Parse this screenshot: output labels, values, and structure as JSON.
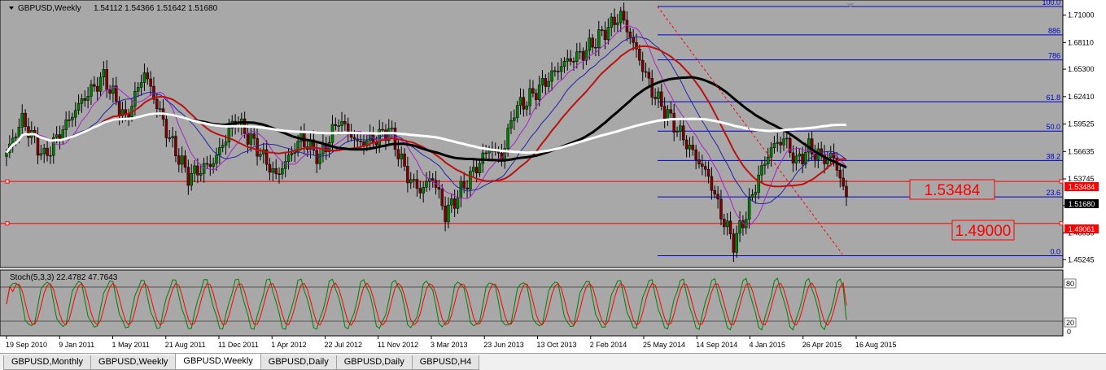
{
  "header": {
    "symbol": "GBPUSD,Weekly",
    "ohlc": "1.54112 1.54366 1.51642 1.51680"
  },
  "stoch_header": "Stoch(5,3,3) 22.4782 47.7643",
  "colors": {
    "chart_bg": "#a8a8a8",
    "grid": "#909090",
    "candle_up": "#008000",
    "candle_down": "#800000",
    "fib_line": "#0000cc",
    "hline": "#ff0000",
    "stoch_main": "#008000",
    "stoch_signal": "#ff0000",
    "ma_white": "#ffffff",
    "ma_black": "#000000",
    "ma_red": "#bb1111",
    "ma_blue": "#2222aa",
    "ma_purple": "#aa22cc"
  },
  "price_axis": {
    "ticks": [
      "1.71000",
      "1.68110",
      "1.65300",
      "1.62410",
      "1.59525",
      "1.56635",
      "1.53745",
      "1.50940",
      "1.48050",
      "1.45245"
    ],
    "current_price": "1.51680",
    "line_1_label": "1.53484",
    "line_2_label": "1.49061"
  },
  "time_axis": {
    "labels": [
      "19 Sep 2010",
      "9 Jan 2011",
      "1 May 2011",
      "21 Aug 2011",
      "11 Dec 2011",
      "1 Apr 2012",
      "22 Jul 2012",
      "11 Nov 2012",
      "3 Mar 2013",
      "23 Jun 2013",
      "13 Oct 2013",
      "2 Feb 2014",
      "25 May 2014",
      "14 Sep 2014",
      "4 Jan 2015",
      "26 Apr 2015",
      "16 Aug 2015"
    ]
  },
  "fib_levels": [
    "100.0",
    "886",
    "786",
    "61.8",
    "50.0",
    "38.2",
    "23.6",
    "0.0"
  ],
  "big_labels": {
    "level_1": "1.53484",
    "level_2": "1.49000"
  },
  "stoch_axis": [
    "80",
    "20",
    "0"
  ],
  "tabs": [
    {
      "label": "GBPUSD,Monthly",
      "active": false
    },
    {
      "label": "GBPUSD,Weekly",
      "active": false
    },
    {
      "label": "GBPUSD,Weekly",
      "active": true
    },
    {
      "label": "GBPUSD,Daily",
      "active": false
    },
    {
      "label": "GBPUSD,Daily",
      "active": false
    },
    {
      "label": "GBPUSD,H4",
      "active": false
    }
  ],
  "chart_data": {
    "type": "candlestick",
    "symbol": "GBPUSD",
    "timeframe": "Weekly",
    "ylim": [
      1.445,
      1.725
    ],
    "horizontal_lines": [
      1.53484,
      1.49061
    ],
    "fibonacci": {
      "high": 1.719,
      "low": 1.4566,
      "levels": [
        {
          "label": "100.0",
          "price": 1.719
        },
        {
          "label": "886",
          "price": 1.6891
        },
        {
          "label": "786",
          "price": 1.6628
        },
        {
          "label": "61.8",
          "price": 1.6187
        },
        {
          "label": "50.0",
          "price": 1.5878
        },
        {
          "label": "38.2",
          "price": 1.5568
        },
        {
          "label": "23.6",
          "price": 1.5185
        },
        {
          "label": "0.0",
          "price": 1.4566
        }
      ]
    },
    "price_path": [
      [
        0,
        1.565
      ],
      [
        5,
        1.6
      ],
      [
        12,
        1.56
      ],
      [
        18,
        1.59
      ],
      [
        24,
        1.62
      ],
      [
        31,
        1.645
      ],
      [
        38,
        1.6
      ],
      [
        44,
        1.65
      ],
      [
        52,
        1.58
      ],
      [
        58,
        1.54
      ],
      [
        66,
        1.555
      ],
      [
        73,
        1.6
      ],
      [
        80,
        1.57
      ],
      [
        86,
        1.54
      ],
      [
        94,
        1.58
      ],
      [
        100,
        1.56
      ],
      [
        106,
        1.6
      ],
      [
        112,
        1.575
      ],
      [
        118,
        1.58
      ],
      [
        122,
        1.59
      ],
      [
        128,
        1.54
      ],
      [
        132,
        1.525
      ],
      [
        136,
        1.54
      ],
      [
        140,
        1.5
      ],
      [
        145,
        1.525
      ],
      [
        150,
        1.55
      ],
      [
        154,
        1.57
      ],
      [
        158,
        1.56
      ],
      [
        162,
        1.61
      ],
      [
        166,
        1.62
      ],
      [
        172,
        1.64
      ],
      [
        178,
        1.66
      ],
      [
        184,
        1.67
      ],
      [
        190,
        1.69
      ],
      [
        196,
        1.71
      ],
      [
        200,
        1.68
      ],
      [
        206,
        1.63
      ],
      [
        212,
        1.6
      ],
      [
        218,
        1.57
      ],
      [
        224,
        1.54
      ],
      [
        228,
        1.5
      ],
      [
        232,
        1.47
      ],
      [
        236,
        1.5
      ],
      [
        240,
        1.54
      ],
      [
        244,
        1.57
      ],
      [
        248,
        1.58
      ],
      [
        252,
        1.555
      ],
      [
        256,
        1.57
      ],
      [
        260,
        1.56
      ],
      [
        264,
        1.56
      ],
      [
        268,
        1.517
      ]
    ],
    "indicator": {
      "name": "Stoch(5,3,3)",
      "main": 22.4782,
      "signal": 47.7643,
      "levels": [
        80,
        20
      ]
    }
  }
}
